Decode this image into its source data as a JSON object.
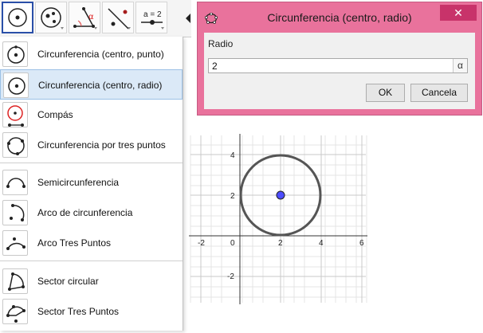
{
  "toolbar": {
    "buttons": [
      {
        "name": "circle-center-point-tool",
        "icon": "circle-with-center-icon"
      },
      {
        "name": "point-tools",
        "icon": "points-in-circle-icon"
      },
      {
        "name": "angle-tool",
        "icon": "angle-alpha-icon",
        "alpha": "α"
      },
      {
        "name": "reflect-tool",
        "icon": "line-reflect-icon"
      },
      {
        "name": "slider-tool",
        "icon": "slider-icon",
        "label": "a = 2"
      }
    ]
  },
  "menu": {
    "items": [
      {
        "label": "Circunferencia (centro, punto)",
        "icon": "circle-center-point-icon"
      },
      {
        "label": "Circunferencia (centro, radio)",
        "icon": "circle-center-radius-icon",
        "selected": true
      },
      {
        "label": "Compás",
        "icon": "compass-icon"
      },
      {
        "label": "Circunferencia por tres puntos",
        "icon": "circle-three-points-icon"
      },
      {
        "label": "Semicircunferencia",
        "icon": "semicircle-icon"
      },
      {
        "label": "Arco de circunferencia",
        "icon": "circular-arc-icon"
      },
      {
        "label": "Arco Tres Puntos",
        "icon": "three-point-arc-icon"
      },
      {
        "label": "Sector circular",
        "icon": "circular-sector-icon"
      },
      {
        "label": "Sector Tres Puntos",
        "icon": "three-point-sector-icon"
      }
    ]
  },
  "dialog": {
    "title": "Circunferencia (centro, radio)",
    "close": "✕",
    "field_label": "Radio",
    "value": "2",
    "alpha": "α",
    "ok": "OK",
    "cancel": "Cancela",
    "title_bar_color": "#e9729c"
  },
  "graph": {
    "x_ticks": [
      "-2",
      "0",
      "2",
      "4",
      "6"
    ],
    "y_ticks": [
      "4",
      "2",
      "-2"
    ],
    "circle": {
      "center_x": 2,
      "center_y": 2,
      "radius": 2
    },
    "point_color": "#4d4dff"
  }
}
